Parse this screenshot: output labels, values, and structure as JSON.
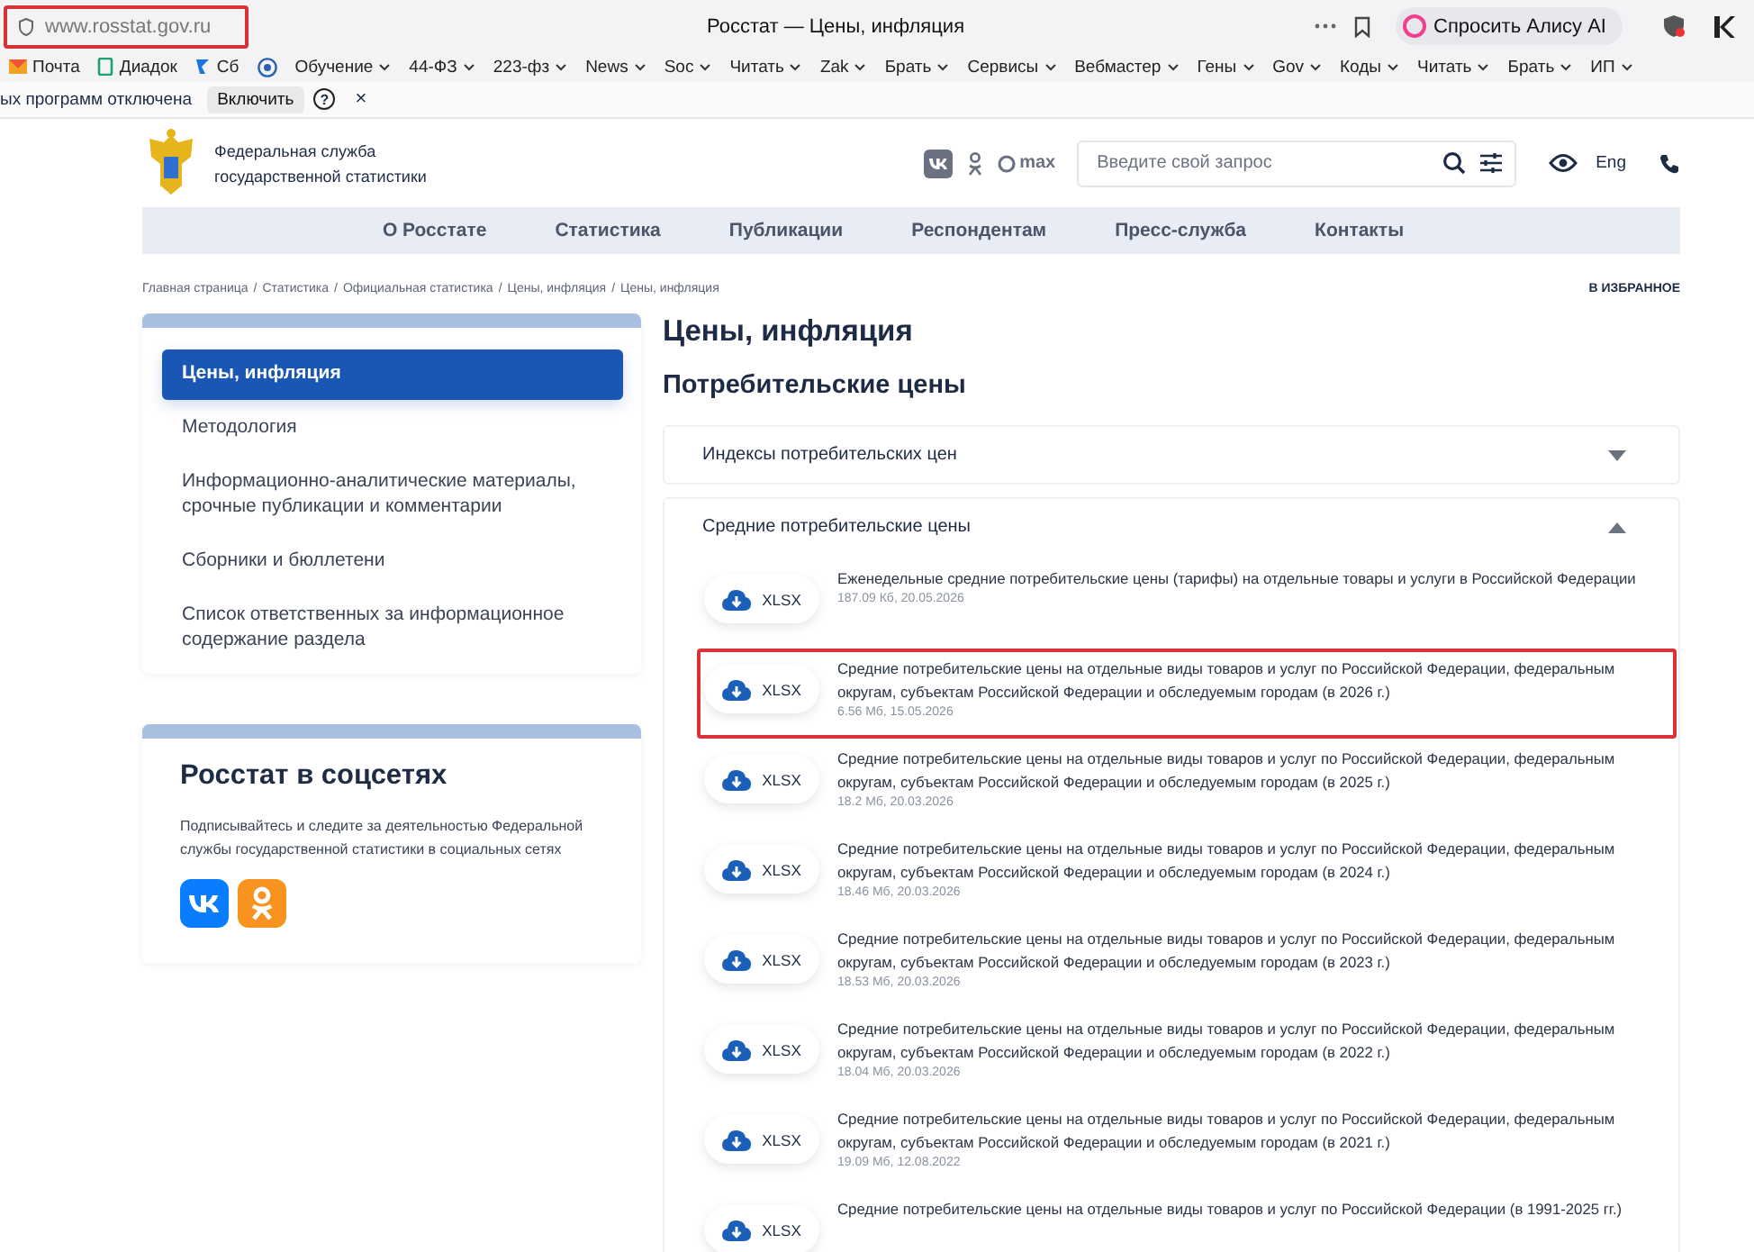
{
  "browser": {
    "address": {
      "text": "www.rosstat.gov.ru",
      "highlighted": true
    },
    "tab_title": "Росстат — Цены, инфляция",
    "assistant_button": "Спросить Алису AI",
    "bookmarks": [
      {
        "label": "Почта",
        "kind": "mail"
      },
      {
        "label": "Диадок",
        "kind": "doc"
      },
      {
        "label": "Сб",
        "kind": "bird"
      },
      {
        "kind": "globe"
      },
      {
        "label": "Обучение",
        "kind": "folder"
      },
      {
        "label": "44-ФЗ",
        "kind": "folder"
      },
      {
        "label": "223-фз",
        "kind": "folder"
      },
      {
        "label": "News",
        "kind": "folder"
      },
      {
        "label": "Soc",
        "kind": "folder"
      },
      {
        "label": "Читать",
        "kind": "folder"
      },
      {
        "label": "Zak",
        "kind": "folder"
      },
      {
        "label": "Брать",
        "kind": "folder"
      },
      {
        "label": "Сервисы",
        "kind": "folder"
      },
      {
        "label": "Вебмастер",
        "kind": "folder"
      },
      {
        "label": "Гены",
        "kind": "folder"
      },
      {
        "label": "Gov",
        "kind": "folder"
      },
      {
        "label": "Коды",
        "kind": "folder"
      },
      {
        "label": "Читать",
        "kind": "folder"
      },
      {
        "label": "Брать",
        "kind": "folder"
      },
      {
        "label": "ИП",
        "kind": "folder"
      }
    ],
    "notice": {
      "text": "ых программ отключена",
      "button": "Включить",
      "help": "?",
      "close": "×"
    }
  },
  "header": {
    "org_name": [
      "Федеральная служба",
      "государственной статистики"
    ],
    "max_label": "max",
    "search_placeholder": "Введите свой запрос",
    "language": "Eng"
  },
  "nav": [
    "О Росстате",
    "Статистика",
    "Публикации",
    "Респондентам",
    "Пресс-служба",
    "Контакты"
  ],
  "breadcrumbs": [
    "Главная страница",
    "Статистика",
    "Официальная статистика",
    "Цены, инфляция",
    "Цены, инфляция"
  ],
  "breadcrumb_separator": "/",
  "favorite": "В ИЗБРАННОЕ",
  "sidebar": {
    "items": [
      {
        "label": "Цены, инфляция",
        "selected": true
      },
      {
        "label": "Методология",
        "selected": false
      },
      {
        "label": "Информационно-аналитические материалы, срочные публикации и комментарии",
        "selected": false
      },
      {
        "label": "Сборники и бюллетени",
        "selected": false
      },
      {
        "label": "Список ответственных за информационное содержание раздела",
        "selected": false
      }
    ]
  },
  "social_card": {
    "title": "Росстат в соцсетях",
    "text": "Подписывайтесь и следите за деятельностью Федеральной службы государственной статистики в социальных сетях"
  },
  "title": "Цены, инфляция",
  "subtitle": "Потребительские цены",
  "sections": [
    {
      "title": "Индексы потребительских цен",
      "expanded": false
    },
    {
      "title": "Средние потребительские цены",
      "expanded": true,
      "files": [
        {
          "format": "XLSX",
          "name": "Еженедельные средние потребительские цены (тарифы) на отдельные товары и услуги в Российской Федерации",
          "meta": "187.09 Кб, 20.05.2026",
          "highlighted": false
        },
        {
          "format": "XLSX",
          "name": "Средние потребительские цены на отдельные виды товаров и услуг по Российской Федерации, федеральным округам, субъектам Российской Федерации и обследуемым городам (в 2026 г.)",
          "meta": "6.56 Мб, 15.05.2026",
          "highlighted": true
        },
        {
          "format": "XLSX",
          "name": "Средние потребительские цены на отдельные виды товаров и услуг по Российской Федерации, федеральным округам, субъектам Российской Федерации и обследуемым городам (в 2025 г.)",
          "meta": "18.2 Мб, 20.03.2026",
          "highlighted": false
        },
        {
          "format": "XLSX",
          "name": "Средние потребительские цены на отдельные виды товаров и услуг по Российской Федерации, федеральным округам, субъектам Российской Федерации и обследуемым городам (в 2024 г.)",
          "meta": "18.46 Мб, 20.03.2026",
          "highlighted": false
        },
        {
          "format": "XLSX",
          "name": "Средние потребительские цены на отдельные виды товаров и услуг по Российской Федерации, федеральным округам, субъектам Российской Федерации и обследуемым городам (в 2023 г.)",
          "meta": "18.53 Мб, 20.03.2026",
          "highlighted": false
        },
        {
          "format": "XLSX",
          "name": "Средние потребительские цены на отдельные виды товаров и услуг по Российской Федерации, федеральным округам, субъектам Российской Федерации и обследуемым городам (в 2022 г.)",
          "meta": "18.04 Мб, 20.03.2026",
          "highlighted": false
        },
        {
          "format": "XLSX",
          "name": "Средние потребительские цены на отдельные виды товаров и услуг по Российской Федерации, федеральным округам, субъектам Российской Федерации и обследуемым городам (в 2021 г.)",
          "meta": "19.09 Мб, 12.08.2022",
          "highlighted": false
        },
        {
          "format": "XLSX",
          "name": "Средние потребительские цены на отдельные виды товаров и услуг по Российской Федерации (в 1991-2025 гг.)",
          "highlighted": false
        }
      ]
    }
  ]
}
